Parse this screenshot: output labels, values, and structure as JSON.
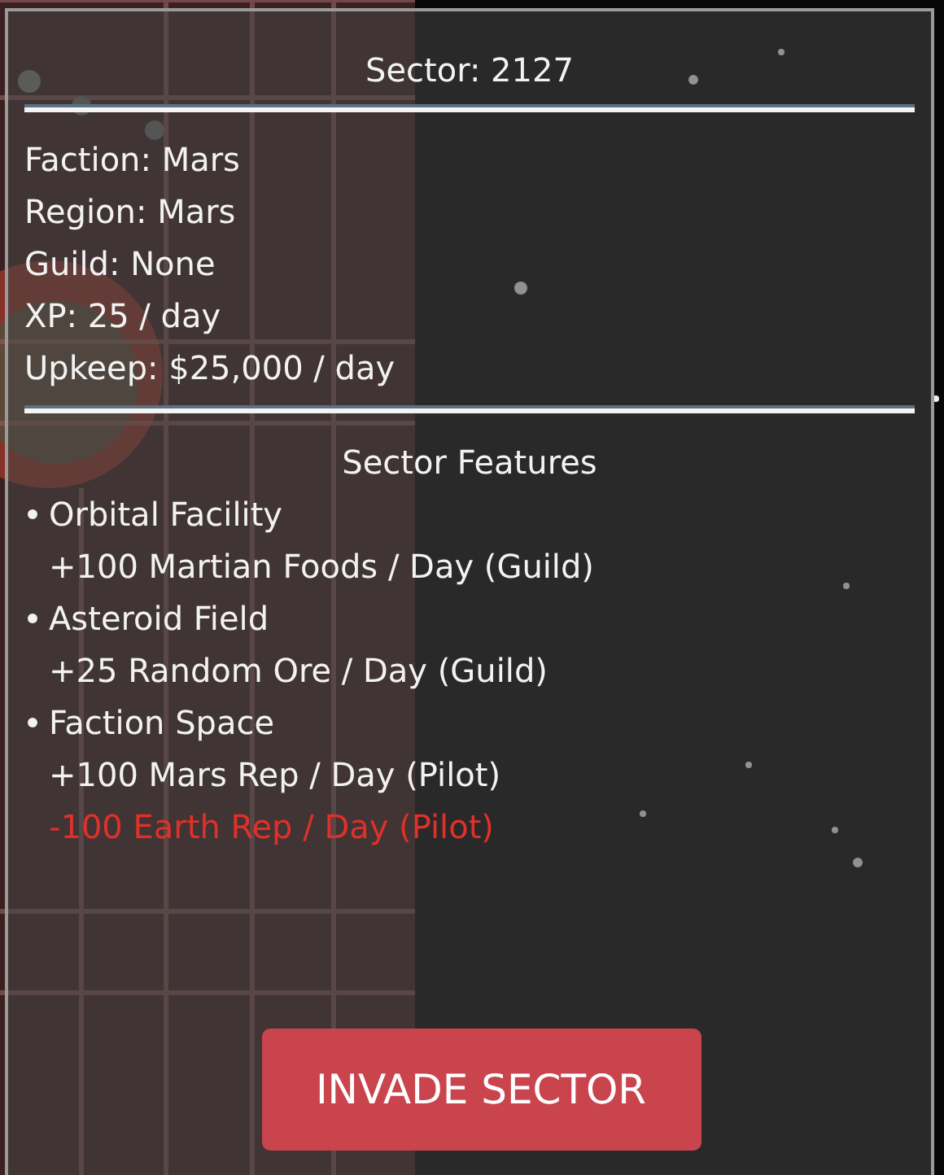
{
  "title": "Sector: 2127",
  "details": [
    "Faction: Mars",
    "Region: Mars",
    "Guild: None",
    "XP: 25 / day",
    "Upkeep: $25,000 / day"
  ],
  "features_heading": "Sector Features",
  "features": [
    {
      "name": "Orbital Facility",
      "effects": [
        {
          "text": "+100 Martian Foods / Day (Guild)",
          "kind": "bonus"
        }
      ]
    },
    {
      "name": "Asteroid Field",
      "effects": [
        {
          "text": "+25 Random Ore / Day (Guild)",
          "kind": "bonus"
        }
      ]
    },
    {
      "name": "Faction Space",
      "effects": [
        {
          "text": "+100 Mars Rep / Day (Pilot)",
          "kind": "bonus"
        },
        {
          "text": "-100 Earth Rep / Day (Pilot)",
          "kind": "penalty"
        }
      ]
    }
  ],
  "action": "INVADE SECTOR"
}
